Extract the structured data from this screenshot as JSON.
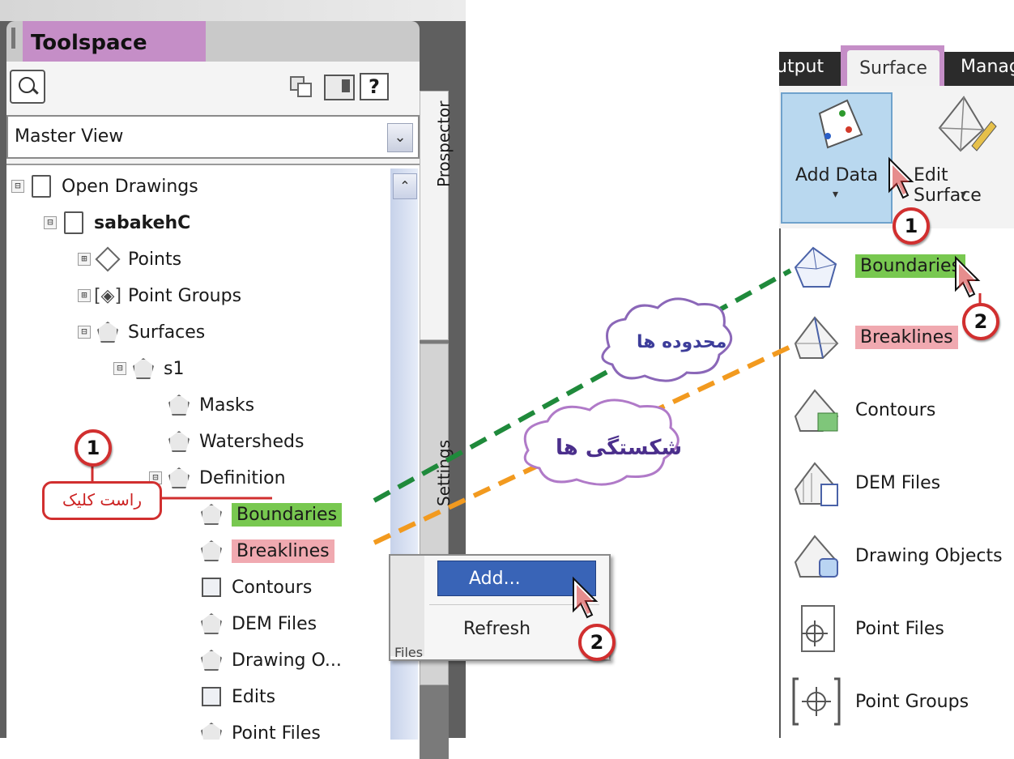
{
  "toolspace": {
    "title": "Toolspace",
    "view_selector": "Master View",
    "tabs": [
      "Prospector",
      "Settings"
    ],
    "tree": [
      {
        "label": "Open Drawings",
        "toggle": "⊟",
        "icon": "document-icon",
        "level": 0
      },
      {
        "label": "sabakehC",
        "toggle": "⊟",
        "icon": "document-icon",
        "level": 1,
        "bold": true
      },
      {
        "label": "Points",
        "toggle": "⊞",
        "icon": "points-icon",
        "level": 2
      },
      {
        "label": "Point Groups",
        "toggle": "⊞",
        "icon": "point-groups-icon",
        "level": 2
      },
      {
        "label": "Surfaces",
        "toggle": "⊟",
        "icon": "surfaces-icon",
        "level": 2
      },
      {
        "label": "s1",
        "toggle": "⊟",
        "icon": "surface-icon",
        "level": 3
      },
      {
        "label": "Masks",
        "icon": "masks-icon",
        "level": 4
      },
      {
        "label": "Watersheds",
        "icon": "watersheds-icon",
        "level": 4
      },
      {
        "label": "Definition",
        "toggle": "⊟",
        "icon": "definition-icon",
        "level": 4
      },
      {
        "label": "Boundaries",
        "icon": "boundaries-icon",
        "level": 5,
        "highlight": "green"
      },
      {
        "label": "Breaklines",
        "icon": "breaklines-icon",
        "level": 5,
        "highlight": "pink"
      },
      {
        "label": "Contours",
        "icon": "contours-icon",
        "level": 5
      },
      {
        "label": "DEM Files",
        "icon": "dem-files-icon",
        "level": 5
      },
      {
        "label": "Drawing O...",
        "icon": "drawing-objects-icon",
        "level": 5
      },
      {
        "label": "Edits",
        "icon": "edits-icon",
        "level": 5
      },
      {
        "label": "Point Files",
        "icon": "point-files-icon",
        "level": 5
      }
    ],
    "hidden_partial_text": "Files"
  },
  "context_menu": {
    "items": [
      "Add...",
      "Refresh"
    ],
    "selected": "Add..."
  },
  "ribbon": {
    "tabs": [
      "utput",
      "Surface",
      "Manag"
    ],
    "active_tab": "Surface",
    "buttons": [
      {
        "label": "Add Data",
        "icon": "add-data-icon",
        "active": true
      },
      {
        "label": "Edit Surface",
        "icon": "edit-surface-icon"
      }
    ],
    "dropdown_arrow": "▾",
    "menu": [
      {
        "label": "Boundaries",
        "icon": "boundaries-icon",
        "highlight": "green"
      },
      {
        "label": "Breaklines",
        "icon": "breaklines-icon",
        "highlight": "pink"
      },
      {
        "label": "Contours",
        "icon": "contours-icon"
      },
      {
        "label": "DEM Files",
        "icon": "dem-files-icon"
      },
      {
        "label": "Drawing Objects",
        "icon": "drawing-objects-icon"
      },
      {
        "label": "Point Files",
        "icon": "point-files-icon"
      },
      {
        "label": "Point Groups",
        "icon": "point-groups-icon"
      }
    ]
  },
  "annotations": {
    "step_1": "1",
    "step_2": "2",
    "right_click": "راست کلیک",
    "boundaries_fa": "محدوده ها",
    "breaklines_fa": "شکستگی ها"
  },
  "colors": {
    "green_highlight": "#78c850",
    "pink_highlight": "#f0a9b0",
    "title_highlight": "#c58ec7",
    "callout_red": "#d12f2f",
    "green_dash": "#1f8a3b",
    "orange_dash": "#f29a1f",
    "cloud_stroke": "#8b67b8"
  }
}
